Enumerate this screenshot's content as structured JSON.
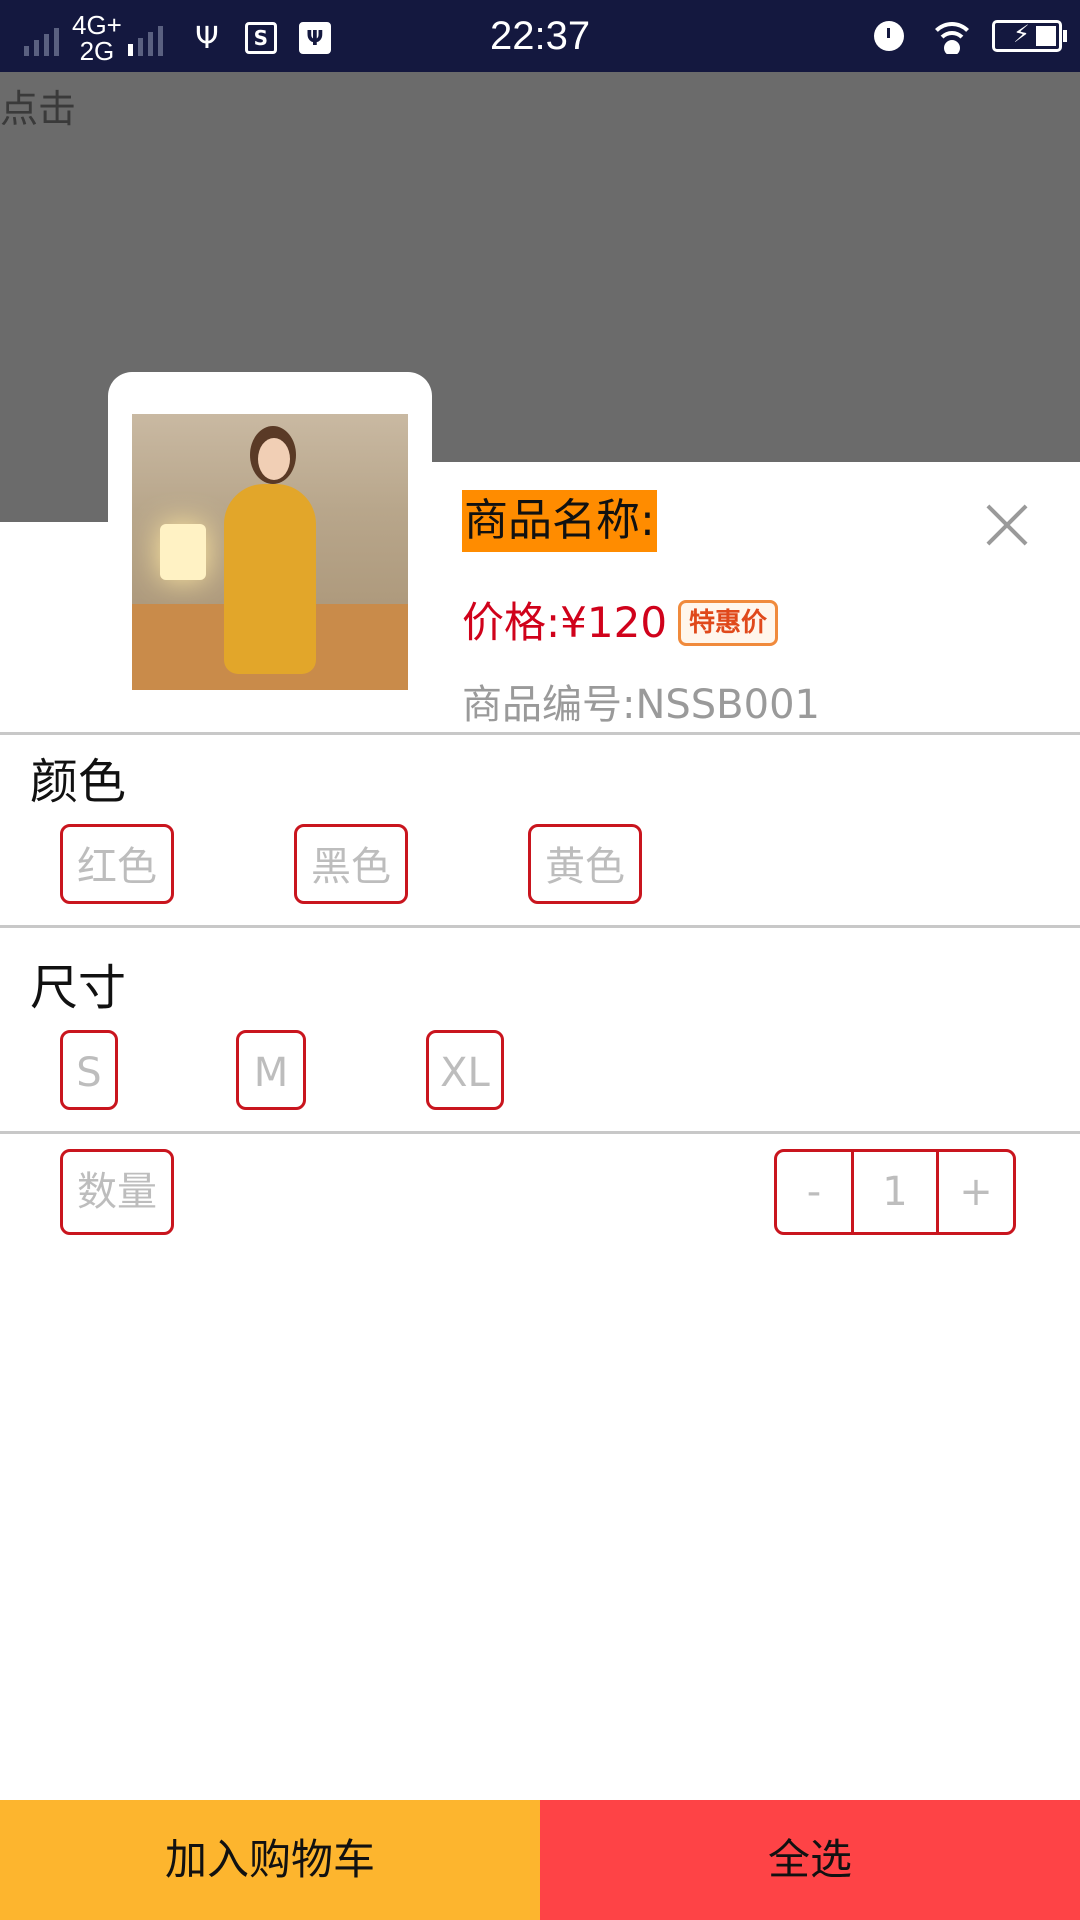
{
  "status_bar": {
    "network_top": "4G+",
    "network_bottom": "2G",
    "time": "22:37"
  },
  "overlay": {
    "tap_label": "点击"
  },
  "product": {
    "name_label": "商品名称:",
    "price_label": "价格:¥120",
    "deal_badge": "特惠价",
    "sku_label": "商品编号:NSSB001"
  },
  "color_section": {
    "title": "颜色",
    "options": [
      "红色",
      "黑色",
      "黄色"
    ]
  },
  "size_section": {
    "title": "尺寸",
    "options": [
      "S",
      "M",
      "XL"
    ]
  },
  "quantity": {
    "label": "数量",
    "minus": "-",
    "value": "1",
    "plus": "+"
  },
  "bottom_bar": {
    "add_to_cart": "加入购物车",
    "select_all": "全选"
  },
  "colors": {
    "accent_red": "#c9151e",
    "price_red": "#d0021b",
    "name_highlight": "#ff8c00",
    "cart_button": "#fdb52e",
    "select_all_button": "#fe4346",
    "status_bar": "#14183f",
    "dim_overlay": "#6b6b6b"
  }
}
